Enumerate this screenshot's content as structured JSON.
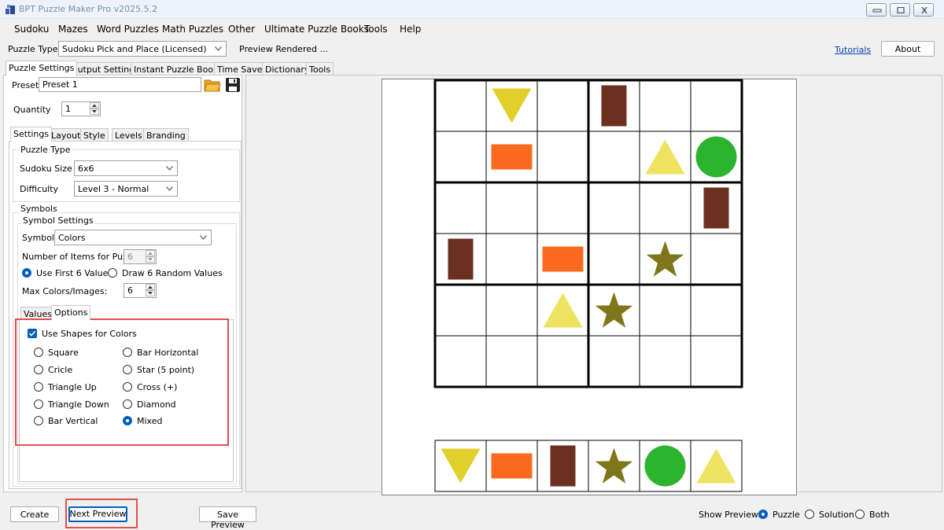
{
  "window": {
    "title": "BPT Puzzle Maker Pro v2025.5.2"
  },
  "menu": [
    "Sudoku",
    "Mazes",
    "Word Puzzles",
    "Math Puzzles",
    "Other",
    "Ultimate Puzzle Books",
    "Tools",
    "Help"
  ],
  "toolbar": {
    "puzzle_type_label": "Puzzle Type",
    "puzzle_type_value": "Sudoku Pick and Place (Licensed)",
    "status": "Preview Rendered ...",
    "tutorials_link": "Tutorials",
    "about_button": "About"
  },
  "main_tabs": [
    "Puzzle Settings",
    "Output Settings",
    "Instant Puzzle Books",
    "Time Saver",
    "Dictionary",
    "Tools"
  ],
  "preset": {
    "label": "Preset",
    "value": "Preset 1"
  },
  "quantity": {
    "label": "Quantity",
    "value": "1"
  },
  "settings_tabs": [
    "Settings",
    "Layout",
    "Style",
    "Levels",
    "Branding"
  ],
  "puzzle_type_group": {
    "title": "Puzzle Type",
    "size_label": "Sudoku Size",
    "size_value": "6x6",
    "difficulty_label": "Difficulty",
    "difficulty_value": "Level 3 - Normal"
  },
  "symbols": {
    "title": "Symbols",
    "settings_title": "Symbol Settings",
    "symbol_label": "Symbol",
    "symbol_value": "Colors",
    "items_label": "Number of Items for Puzzle:",
    "items_value": "6",
    "use_first_label": "Use First 6 Values",
    "draw_random_label": "Draw 6 Random Values",
    "max_label": "Max Colors/Images:",
    "max_value": "6"
  },
  "symbol_tabs": [
    "Values",
    "Options"
  ],
  "options": {
    "use_shapes_label": "Use Shapes for Colors",
    "shapes_left": [
      "Square",
      "Cricle",
      "Triangle Up",
      "Triangle Down",
      "Bar Vertical"
    ],
    "shapes_right": [
      "Bar Horizontal",
      "Star (5 point)",
      "Cross (+)",
      "Diamond",
      "Mixed"
    ],
    "selected": "Mixed"
  },
  "bottom": {
    "create": "Create",
    "next_preview": "Next Preview",
    "save_preview": "Save Preview",
    "show_preview_label": "Show Preview:",
    "show_options": [
      "Puzzle",
      "Solution",
      "Both"
    ],
    "show_selected": "Puzzle"
  },
  "colors": {
    "yellow": "#e1d02c",
    "light_yellow": "#ede361",
    "orange": "#fc6a20",
    "brown": "#6b3020",
    "green": "#2db42e",
    "olive": "#7f761b",
    "accent": "#005fb8",
    "highlight": "#e0504f"
  },
  "puzzle": {
    "size": 6,
    "cells": [
      [
        "",
        "triangle-down",
        "",
        "bar-vertical",
        "",
        ""
      ],
      [
        "",
        "bar-horizontal",
        "",
        "",
        "triangle-up",
        "circle"
      ],
      [
        "",
        "",
        "",
        "",
        "",
        "bar-vertical"
      ],
      [
        "bar-vertical",
        "",
        "bar-horizontal",
        "",
        "star",
        ""
      ],
      [
        "",
        "",
        "triangle-up",
        "star",
        "",
        ""
      ],
      [
        "",
        "",
        "",
        "",
        "",
        ""
      ]
    ],
    "pieces": [
      "triangle-down",
      "bar-horizontal",
      "bar-vertical",
      "star",
      "circle",
      "triangle-up"
    ]
  }
}
